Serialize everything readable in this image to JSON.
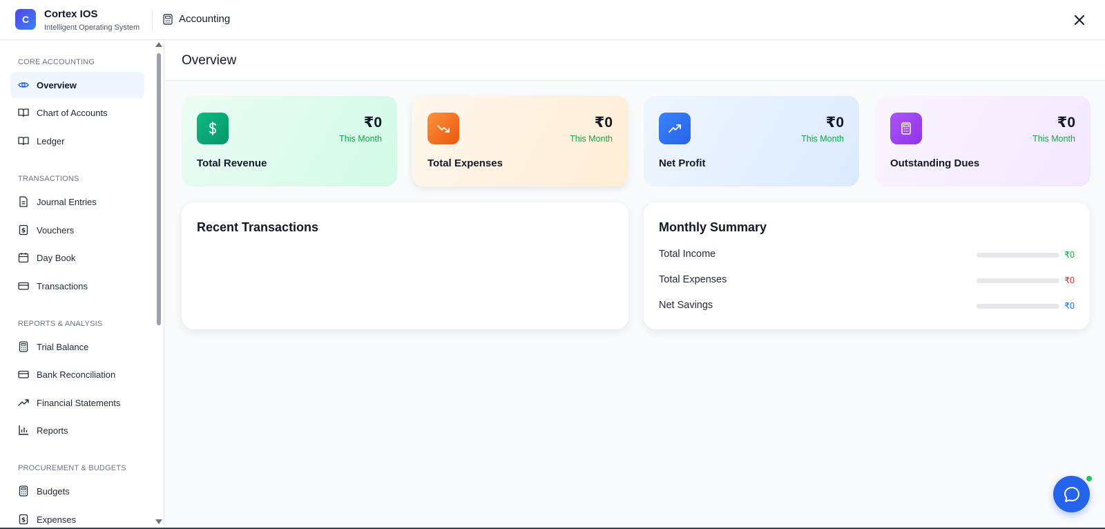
{
  "header": {
    "logo_letter": "C",
    "brand_title": "Cortex IOS",
    "brand_subtitle": "Intelligent Operating System",
    "module_title": "Accounting",
    "close_icon": "close-icon"
  },
  "sidebar": {
    "sections": [
      {
        "label": "CORE ACCOUNTING",
        "items": [
          {
            "label": "Overview",
            "icon": "eye-icon",
            "active": true
          },
          {
            "label": "Chart of Accounts",
            "icon": "book-icon"
          },
          {
            "label": "Ledger",
            "icon": "book-icon"
          }
        ]
      },
      {
        "label": "TRANSACTIONS",
        "items": [
          {
            "label": "Journal Entries",
            "icon": "file-text-icon"
          },
          {
            "label": "Vouchers",
            "icon": "receipt-icon"
          },
          {
            "label": "Day Book",
            "icon": "calendar-icon"
          },
          {
            "label": "Transactions",
            "icon": "credit-card-icon"
          }
        ]
      },
      {
        "label": "REPORTS & ANALYSIS",
        "items": [
          {
            "label": "Trial Balance",
            "icon": "calculator-icon"
          },
          {
            "label": "Bank Reconciliation",
            "icon": "credit-card-icon"
          },
          {
            "label": "Financial Statements",
            "icon": "trending-up-icon"
          },
          {
            "label": "Reports",
            "icon": "bar-chart-icon"
          }
        ]
      },
      {
        "label": "PROCUREMENT & BUDGETS",
        "items": [
          {
            "label": "Budgets",
            "icon": "calculator-icon"
          },
          {
            "label": "Expenses",
            "icon": "receipt-icon"
          }
        ]
      }
    ]
  },
  "main": {
    "page_title": "Overview",
    "cards": [
      {
        "label": "Total Revenue",
        "value": "₹0",
        "period": "This Month",
        "icon": "dollar-icon",
        "accent": "#10b981"
      },
      {
        "label": "Total Expenses",
        "value": "₹0",
        "period": "This Month",
        "icon": "trending-down-icon",
        "accent": "#f97316"
      },
      {
        "label": "Net Profit",
        "value": "₹0",
        "period": "This Month",
        "icon": "trending-up-icon",
        "accent": "#3b82f6"
      },
      {
        "label": "Outstanding Dues",
        "value": "₹0",
        "period": "This Month",
        "icon": "calculator-icon",
        "accent": "#a855f7"
      }
    ],
    "recent_transactions": {
      "title": "Recent Transactions"
    },
    "monthly_summary": {
      "title": "Monthly Summary",
      "rows": [
        {
          "label": "Total Income",
          "value": "₹0",
          "color": "#16a34a"
        },
        {
          "label": "Total Expenses",
          "value": "₹0",
          "color": "#dc2626"
        },
        {
          "label": "Net Savings",
          "value": "₹0",
          "color": "#2563eb"
        }
      ]
    }
  },
  "chat": {
    "icon": "chat-bubble-icon",
    "status_color": "#22c55e"
  }
}
